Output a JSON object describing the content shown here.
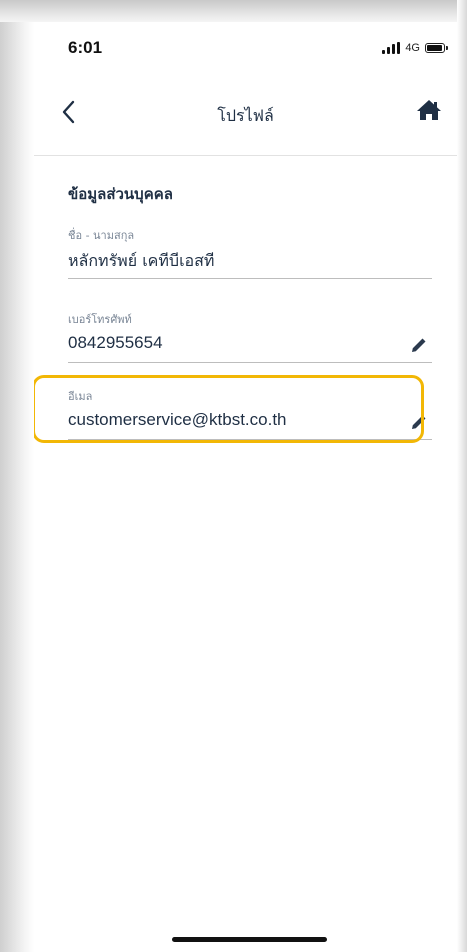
{
  "status_bar": {
    "time": "6:01",
    "network": "4G",
    "icons": [
      "signal-bars-icon",
      "battery-icon"
    ]
  },
  "nav": {
    "title": "โปรไฟล์",
    "back_icon": "chevron-left-icon",
    "home_icon": "home-icon"
  },
  "profile": {
    "section_title": "ข้อมูลส่วนบุคคล",
    "fields": [
      {
        "label": "ชื่อ - นามสกุล",
        "value": "หลักทรัพย์ เคทีบีเอสที",
        "editable": false
      },
      {
        "label": "เบอร์โทรศัพท์",
        "value": "0842955654",
        "editable": true,
        "edit_icon": "pencil-icon"
      },
      {
        "label": "อีเมล",
        "value": "customerservice@ktbst.co.th",
        "editable": true,
        "edit_icon": "pencil-icon",
        "highlighted": true
      }
    ]
  },
  "colors": {
    "text_primary": "#1f2f44",
    "label": "#7a8696",
    "highlight": "#f2b705",
    "icon": "#2b3a4e"
  }
}
